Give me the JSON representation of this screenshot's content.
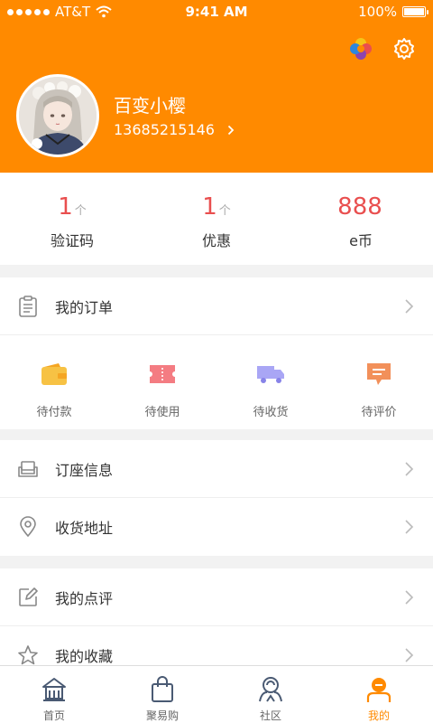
{
  "status_bar": {
    "carrier": "AT&T",
    "time": "9:41 AM",
    "battery": "100%"
  },
  "profile": {
    "name": "百变小樱",
    "phone": "13685215146"
  },
  "stats": [
    {
      "value": "1",
      "unit": "个",
      "label": "验证码"
    },
    {
      "value": "1",
      "unit": "个",
      "label": "优惠"
    },
    {
      "value": "888",
      "unit": "",
      "label": "e币"
    }
  ],
  "orders": {
    "title": "我的订单",
    "items": [
      {
        "label": "待付款",
        "icon": "wallet-icon",
        "color": "#f7c244"
      },
      {
        "label": "待使用",
        "icon": "ticket-icon",
        "color": "#f47c82"
      },
      {
        "label": "待收货",
        "icon": "truck-icon",
        "color": "#a9a6f5"
      },
      {
        "label": "待评价",
        "icon": "comment-icon",
        "color": "#f2905a"
      }
    ]
  },
  "menu_group_1": [
    {
      "label": "订座信息",
      "icon": "sofa-icon"
    },
    {
      "label": "收货地址",
      "icon": "location-pin-icon"
    }
  ],
  "menu_group_2": [
    {
      "label": "我的点评",
      "icon": "edit-icon"
    },
    {
      "label": "我的收藏",
      "icon": "star-icon"
    }
  ],
  "tabs": [
    {
      "label": "首页",
      "icon": "home-icon",
      "active": false
    },
    {
      "label": "聚易购",
      "icon": "shopping-bag-icon",
      "active": false
    },
    {
      "label": "社区",
      "icon": "community-icon",
      "active": false
    },
    {
      "label": "我的",
      "icon": "profile-icon",
      "active": true
    }
  ],
  "colors": {
    "header": "#ff8a00",
    "stat_number": "#e94f4f",
    "active_tab": "#ff8a00"
  }
}
